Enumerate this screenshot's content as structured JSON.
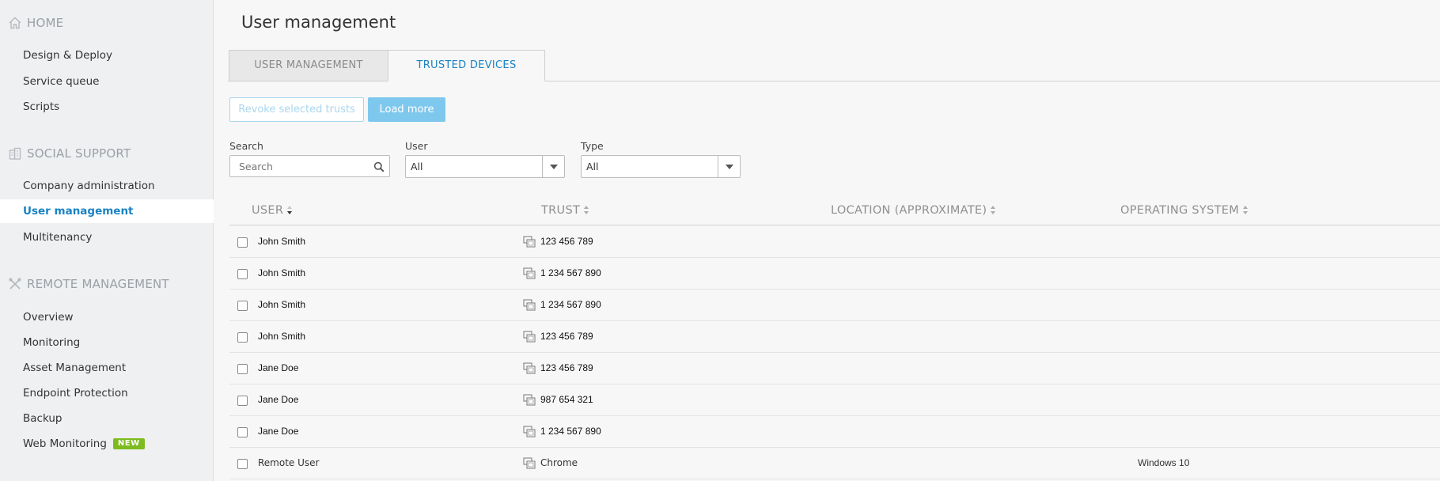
{
  "sidebar": {
    "sections": [
      {
        "title": "HOME",
        "icon": "home-icon",
        "items": [
          {
            "label": "Design & Deploy"
          },
          {
            "label": "Service queue"
          },
          {
            "label": "Scripts"
          }
        ]
      },
      {
        "title": "SOCIAL SUPPORT",
        "icon": "building-icon",
        "items": [
          {
            "label": "Company administration"
          },
          {
            "label": "User management",
            "active": true
          },
          {
            "label": "Multitenancy"
          }
        ]
      },
      {
        "title": "REMOTE MANAGEMENT",
        "icon": "tools-icon",
        "items": [
          {
            "label": "Overview"
          },
          {
            "label": "Monitoring"
          },
          {
            "label": "Asset Management"
          },
          {
            "label": "Endpoint Protection"
          },
          {
            "label": "Backup"
          },
          {
            "label": "Web Monitoring",
            "badge": "NEW"
          }
        ]
      }
    ]
  },
  "page": {
    "title": "User management"
  },
  "tabs": [
    {
      "label": "USER MANAGEMENT",
      "active": false
    },
    {
      "label": "TRUSTED DEVICES",
      "active": true
    }
  ],
  "actions": {
    "revoke_label": "Revoke selected trusts",
    "load_more_label": "Load more"
  },
  "filters": {
    "search_label": "Search",
    "search_placeholder": "Search",
    "user_label": "User",
    "user_value": "All",
    "type_label": "Type",
    "type_value": "All"
  },
  "table": {
    "columns": [
      {
        "label": "USER",
        "sort": "desc"
      },
      {
        "label": "TRUST",
        "sort": "none"
      },
      {
        "label": "LOCATION (APPROXIMATE)",
        "sort": "none"
      },
      {
        "label": "OPERATING SYSTEM",
        "sort": "none"
      }
    ],
    "rows": [
      {
        "user": "John Smith",
        "trust": "123 456 789",
        "location": "",
        "os": ""
      },
      {
        "user": "John Smith",
        "trust": "1 234 567 890",
        "location": "",
        "os": ""
      },
      {
        "user": "John Smith",
        "trust": "1 234 567 890",
        "location": "",
        "os": ""
      },
      {
        "user": "John Smith",
        "trust": "123 456 789",
        "location": "",
        "os": ""
      },
      {
        "user": "Jane Doe",
        "trust": "123 456 789",
        "location": "",
        "os": ""
      },
      {
        "user": "Jane Doe",
        "trust": "987 654 321",
        "location": "",
        "os": ""
      },
      {
        "user": "Jane Doe",
        "trust": "1 234 567 890",
        "location": "",
        "os": ""
      },
      {
        "user": "Remote User",
        "trust": "Chrome",
        "location": "",
        "os": "Windows 10"
      }
    ]
  },
  "colors": {
    "accent": "#1a82c4",
    "button_light": "#7ec8ee",
    "badge_green": "#7dbb1e"
  }
}
